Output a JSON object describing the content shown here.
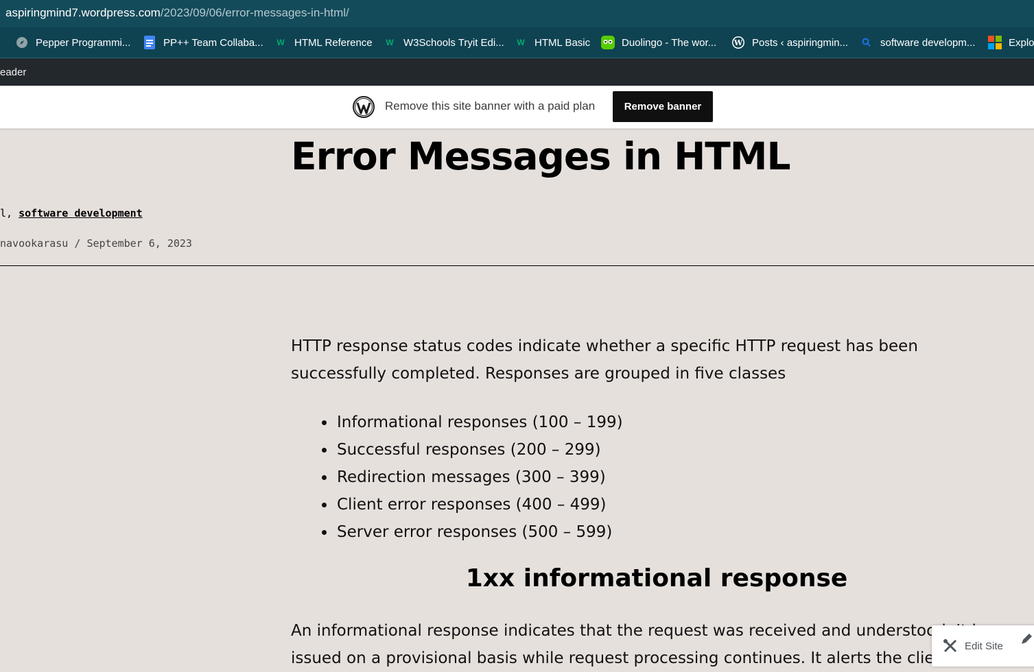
{
  "browser": {
    "url_host": "aspiringmind7.wordpress.com",
    "url_path": "/2023/09/06/error-messages-in-html/",
    "bookmarks": [
      {
        "label": "Pepper Programmi...",
        "icon": "compass-icon"
      },
      {
        "label": "PP++ Team Collaba...",
        "icon": "docs-icon"
      },
      {
        "label": "HTML Reference",
        "icon": "w3schools-icon"
      },
      {
        "label": "W3Schools Tryit Edi...",
        "icon": "w3schools-icon"
      },
      {
        "label": "HTML Basic",
        "icon": "w3schools-icon"
      },
      {
        "label": "Duolingo - The wor...",
        "icon": "duolingo-icon"
      },
      {
        "label": "Posts ‹ aspiringmin...",
        "icon": "wordpress-icon"
      },
      {
        "label": "software developm...",
        "icon": "search-icon"
      },
      {
        "label": "Explo",
        "icon": "microsoft-icon"
      }
    ]
  },
  "adminbar": {
    "reader_label": "eader"
  },
  "banner": {
    "text": "Remove this site banner with a paid plan",
    "button_label": "Remove banner"
  },
  "post": {
    "title": "Error Messages in HTML",
    "category_prefix": "l,",
    "category": "software development",
    "author": "navookarasu",
    "separator": "/",
    "date": "September 6, 2023",
    "intro": "HTTP response status codes indicate whether a specific HTTP request has been successfully completed. Responses are grouped in five classes",
    "classes": [
      "Informational responses (100 – 199)",
      "Successful responses  (200 – 299)",
      "Redirection messages  (300 – 399)",
      "Client error responses  (400 – 499)",
      "Server error responses  (500 – 599)"
    ],
    "heading_1xx": "1xx informational response",
    "para_line1": "An informational response indicates that the request was received and understood. It is",
    "para_line2": "issued on a provisional basis while request processing continues. It alerts the client to wait"
  },
  "edit_site": {
    "label": "Edit Site"
  },
  "colors": {
    "page_bg": "#e6e0dd",
    "url_bar": "#144b5a",
    "admin_bar": "#23282d",
    "button_bg": "#101010"
  }
}
